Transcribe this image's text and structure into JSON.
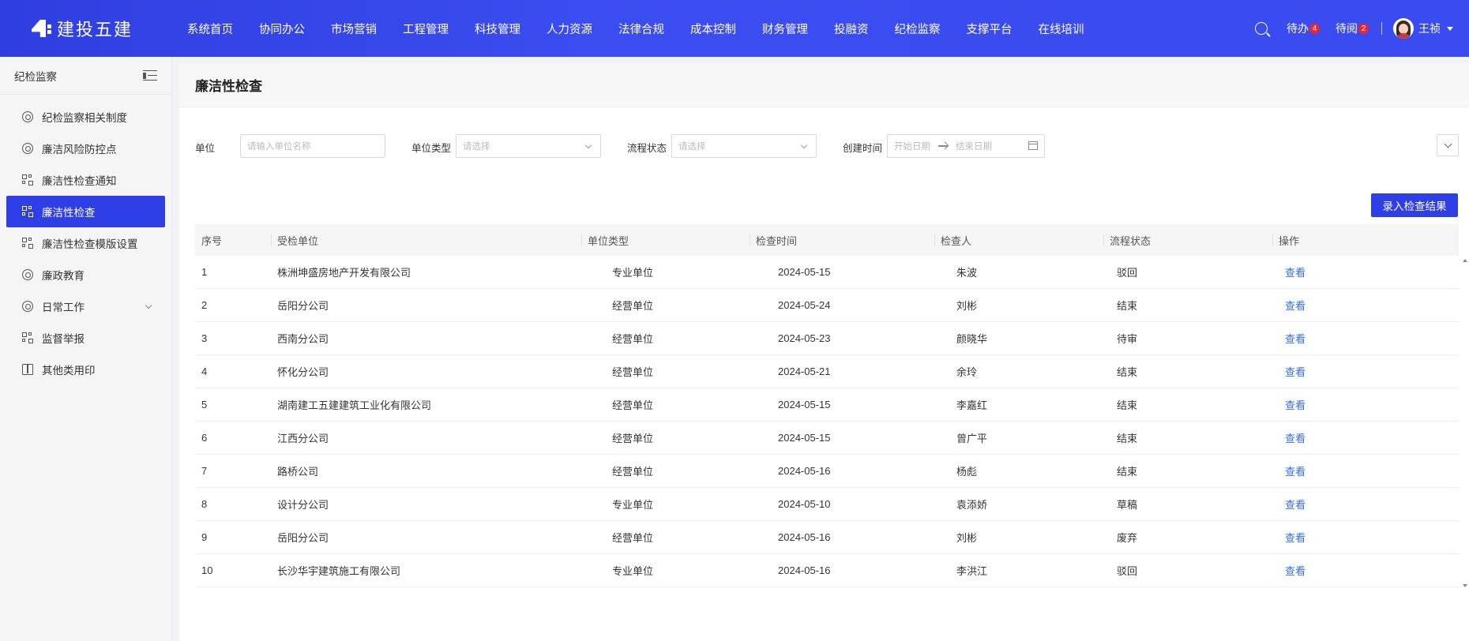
{
  "app": {
    "logo_text": "建投五建"
  },
  "nav": [
    {
      "label": "系统首页"
    },
    {
      "label": "协同办公"
    },
    {
      "label": "市场营销"
    },
    {
      "label": "工程管理"
    },
    {
      "label": "科技管理"
    },
    {
      "label": "人力资源"
    },
    {
      "label": "法律合规"
    },
    {
      "label": "成本控制"
    },
    {
      "label": "财务管理"
    },
    {
      "label": "投融资"
    },
    {
      "label": "纪检监察"
    },
    {
      "label": "支撑平台"
    },
    {
      "label": "在线培训"
    }
  ],
  "header_right": {
    "todo_label": "待办",
    "todo_count": "4",
    "toread_label": "待阅",
    "toread_count": "2",
    "user_name": "王祯"
  },
  "sidebar": {
    "title": "纪检监察",
    "items": [
      {
        "label": "纪检监察相关制度",
        "icon": "gear-icon"
      },
      {
        "label": "廉洁风险防控点",
        "icon": "gear-icon"
      },
      {
        "label": "廉洁性检查通知",
        "icon": "grid-icon"
      },
      {
        "label": "廉洁性检查",
        "icon": "grid-icon"
      },
      {
        "label": "廉洁性检查模版设置",
        "icon": "grid-icon"
      },
      {
        "label": "廉政教育",
        "icon": "gear-icon"
      },
      {
        "label": "日常工作",
        "icon": "gear-icon"
      },
      {
        "label": "监督举报",
        "icon": "grid-icon"
      },
      {
        "label": "其他类用印",
        "icon": "book-icon"
      }
    ]
  },
  "page": {
    "title": "廉洁性检查"
  },
  "filters": {
    "unit_label": "单位",
    "unit_placeholder": "请输入单位名称",
    "type_label": "单位类型",
    "type_placeholder": "请选择",
    "status_label": "流程状态",
    "status_placeholder": "请选择",
    "created_label": "创建时间",
    "start_placeholder": "开始日期",
    "end_placeholder": "结束日期"
  },
  "actions": {
    "record_button": "录入检查结果"
  },
  "table": {
    "headers": {
      "no": "序号",
      "unit": "受检单位",
      "type": "单位类型",
      "time": "检查时间",
      "person": "检查人",
      "status": "流程状态",
      "op": "操作"
    },
    "rows": [
      {
        "no": "1",
        "unit": "株洲坤盛房地产开发有限公司",
        "type": "专业单位",
        "time": "2024-05-15",
        "person": "朱波",
        "status": "驳回",
        "op": "查看"
      },
      {
        "no": "2",
        "unit": "岳阳分公司",
        "type": "经营单位",
        "time": "2024-05-24",
        "person": "刘彬",
        "status": "结束",
        "op": "查看"
      },
      {
        "no": "3",
        "unit": "西南分公司",
        "type": "经营单位",
        "time": "2024-05-23",
        "person": "颜晓华",
        "status": "待审",
        "op": "查看"
      },
      {
        "no": "4",
        "unit": "怀化分公司",
        "type": "经营单位",
        "time": "2024-05-21",
        "person": "余玲",
        "status": "结束",
        "op": "查看"
      },
      {
        "no": "5",
        "unit": "湖南建工五建建筑工业化有限公司",
        "type": "经营单位",
        "time": "2024-05-15",
        "person": "李嘉红",
        "status": "结束",
        "op": "查看"
      },
      {
        "no": "6",
        "unit": "江西分公司",
        "type": "经营单位",
        "time": "2024-05-15",
        "person": "曾广平",
        "status": "结束",
        "op": "查看"
      },
      {
        "no": "7",
        "unit": "路桥公司",
        "type": "经营单位",
        "time": "2024-05-16",
        "person": "杨彪",
        "status": "结束",
        "op": "查看"
      },
      {
        "no": "8",
        "unit": "设计分公司",
        "type": "专业单位",
        "time": "2024-05-10",
        "person": "袁添娇",
        "status": "草稿",
        "op": "查看"
      },
      {
        "no": "9",
        "unit": "岳阳分公司",
        "type": "经营单位",
        "time": "2024-05-16",
        "person": "刘彬",
        "status": "废弃",
        "op": "查看"
      },
      {
        "no": "10",
        "unit": "长沙华宇建筑施工有限公司",
        "type": "专业单位",
        "time": "2024-05-16",
        "person": "李洪江",
        "status": "驳回",
        "op": "查看"
      }
    ]
  },
  "colors": {
    "primary": "#2f3fe6",
    "link": "#2f6bff",
    "badge": "#f5222d"
  }
}
